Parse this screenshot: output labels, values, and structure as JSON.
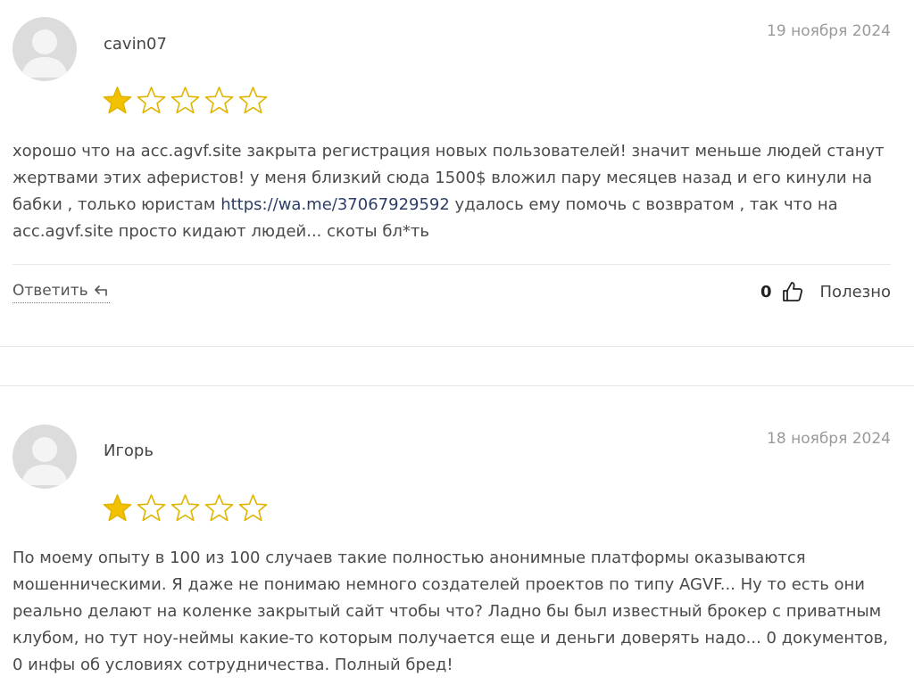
{
  "reviews": [
    {
      "author": "cavin07",
      "date": "19 ноября 2024",
      "rating": 1,
      "max_rating": 5,
      "text_before_link": "хорошо что на acc.agvf.site закрыта регистрация новых пользователей! значит меньше людей станут жертвами этих аферистов! у меня близкий сюда 1500$ вложил пару месяцев назад и его кинули на бабки , только юристам ",
      "link": "https://wa.me/37067929592",
      "text_after_link": " удалось ему помочь с возвратом , так что на acc.agvf.site просто кидают людей... скоты бл*ть",
      "reply_label": "Ответить",
      "helpful_count": "0",
      "helpful_label": "Полезно"
    },
    {
      "author": "Игорь",
      "date": "18 ноября 2024",
      "rating": 1,
      "max_rating": 5,
      "text": "По моему опыту в 100 из 100 случаев такие полностью анонимные платформы оказываются мошенническими. Я даже не понимаю немного создателей проектов по типу AGVF... Ну то есть они реально делают на коленке закрытый сайт чтобы что? Ладно бы был известный брокер с приватным клубом, но тут ноу-неймы какие-то которым получается еще и деньги доверять надо... 0 документов, 0 инфы об условиях сотрудничества. Полный бред!"
    }
  ],
  "colors": {
    "star_filled": "#f2c200",
    "star_outline": "#e0b400",
    "date": "#9a9a9a",
    "link": "#2c3e66"
  }
}
